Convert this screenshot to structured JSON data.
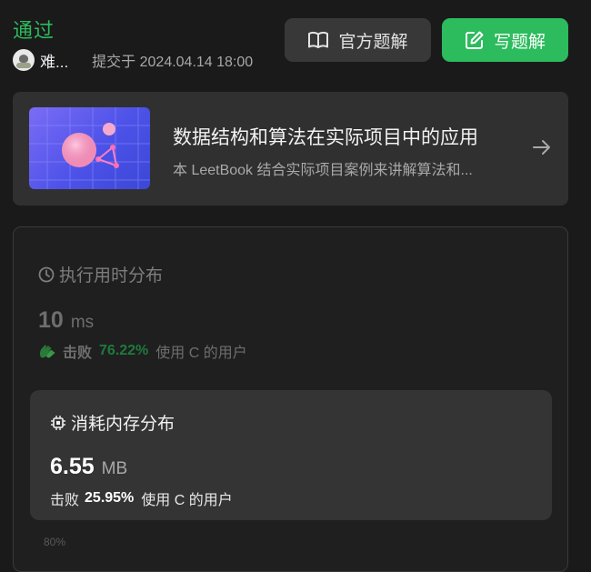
{
  "header": {
    "status": "通过",
    "username": "难...",
    "submitted_at": "提交于 2024.04.14 18:00"
  },
  "buttons": {
    "official_solution": "官方题解",
    "write_solution": "写题解"
  },
  "promo": {
    "title": "数据结构和算法在实际项目中的应用",
    "description": "本 LeetBook 结合实际项目案例来讲解算法和..."
  },
  "runtime": {
    "heading": "执行用时分布",
    "value": "10",
    "unit": "ms",
    "beat_label": "击败",
    "beat_percent": "76.22%",
    "beat_suffix": "使用 C 的用户"
  },
  "memory": {
    "heading": "消耗内存分布",
    "value": "6.55",
    "unit": "MB",
    "beat_label": "击败",
    "beat_percent": "25.95%",
    "beat_suffix": "使用 C 的用户"
  },
  "chart_peek_label": "80%",
  "colors": {
    "accent_green": "#2cbb5d",
    "background": "#1a1a1a",
    "card": "#343434"
  }
}
